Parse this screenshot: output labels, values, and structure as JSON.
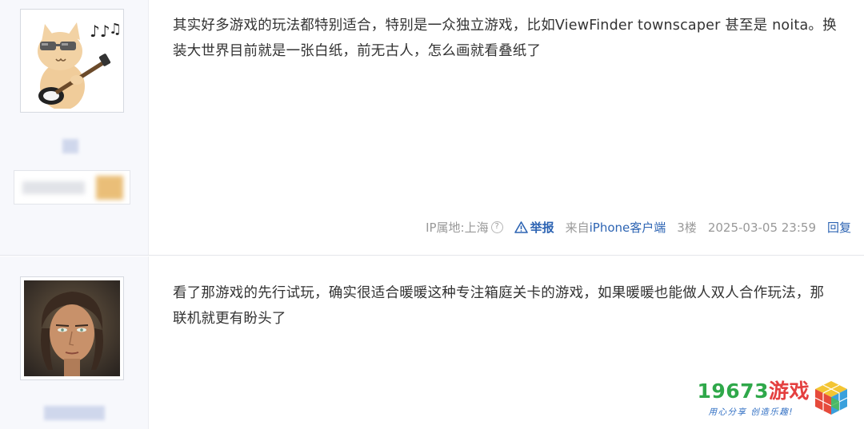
{
  "posts": [
    {
      "content": "其实好多游戏的玩法都特别适合，特别是一众独立游戏，比如ViewFinder townscaper 甚至是 noita。换装大世界目前就是一张白纸，前无古人，怎么画就看叠纸了",
      "meta": {
        "ip": "IP属地:上海",
        "report": "举报",
        "device_prefix": "来自",
        "device": "iPhone客户端",
        "floor": "3楼",
        "time": "2025-03-05 23:59",
        "reply": "回复"
      }
    },
    {
      "content": "看了那游戏的先行试玩，确实很适合暖暖这种专注箱庭关卡的游戏，如果暖暖也能做人双人合作玩法，那联机就更有盼头了"
    }
  ],
  "watermark": {
    "number": "19673",
    "game": "游戏",
    "slogan": "用心分享 创造乐趣!"
  },
  "colors": {
    "link": "#2d64b3",
    "meta": "#999999",
    "sidebar": "#f7f8fc",
    "watermark_green": "#2fa84a",
    "watermark_red": "#e43f3f"
  }
}
